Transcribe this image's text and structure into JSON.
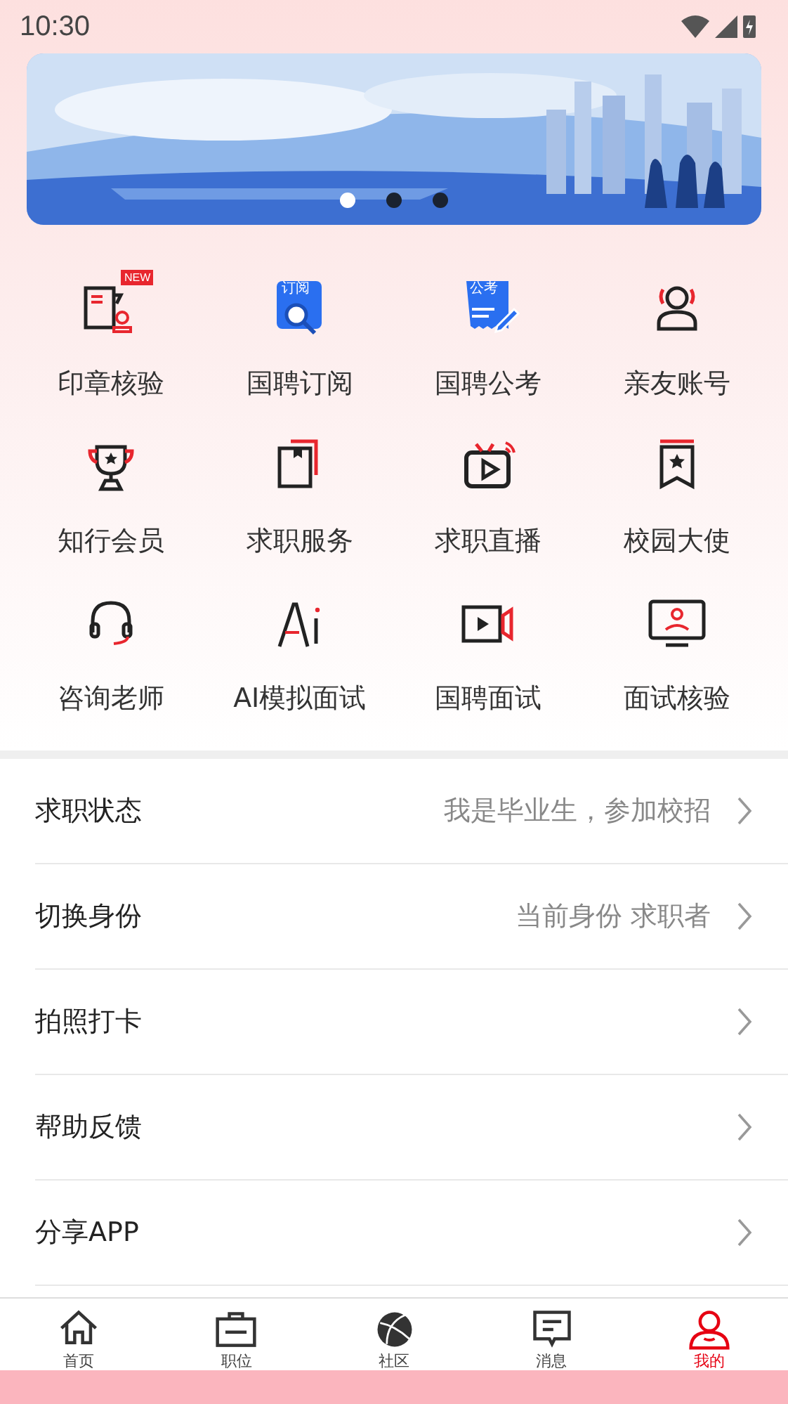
{
  "status_bar": {
    "time": "10:30"
  },
  "banner": {
    "kind": "picture",
    "pages": [
      {
        "selected": true
      },
      {
        "selected": false
      },
      {
        "selected": false
      }
    ]
  },
  "shortcuts": [
    {
      "label": "印章核验",
      "badge": "NEW"
    },
    {
      "label": "国聘订阅",
      "icon_text": "订阅"
    },
    {
      "label": "国聘公考",
      "icon_text": "公考"
    },
    {
      "label": "亲友账号"
    },
    {
      "label": "知行会员"
    },
    {
      "label": "求职服务"
    },
    {
      "label": "求职直播"
    },
    {
      "label": "校园大使"
    },
    {
      "label": "咨询老师"
    },
    {
      "label": "AI模拟面试"
    },
    {
      "label": "国聘面试"
    },
    {
      "label": "面试核验"
    }
  ],
  "settings": [
    {
      "label": "求职状态",
      "value": "我是毕业生，参加校招"
    },
    {
      "label": "切换身份",
      "value": "当前身份 求职者"
    },
    {
      "label": "拍照打卡"
    },
    {
      "label": "帮助反馈"
    },
    {
      "label": "分享APP"
    }
  ],
  "bottom_nav": [
    {
      "label": "首页",
      "selected": false
    },
    {
      "label": "职位",
      "selected": false
    },
    {
      "label": "社区",
      "selected": false
    },
    {
      "label": "消息",
      "selected": false
    },
    {
      "label": "我的",
      "selected": true
    }
  ]
}
